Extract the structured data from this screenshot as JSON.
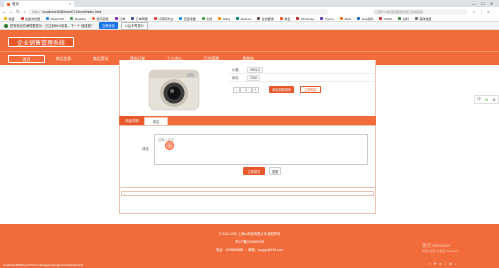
{
  "browser": {
    "tab_title": "首页",
    "tab_close": "×",
    "window_controls": [
      "—",
      "☐",
      "✕"
    ],
    "nav_glyphs": [
      "←",
      "→",
      "↻",
      "⌂"
    ],
    "url_prefix": "http://",
    "url": "localhost:8080/ssm071/front/index.html",
    "search_placeholder": "口罩什么情况还能回去用口罩用完吗",
    "right_glyphs": "☆ ⋮ ≡"
  },
  "bookmarks": [
    {
      "label": "收藏",
      "color": "#f5b400"
    },
    {
      "label": "谷歌浏览器",
      "color": "#e53935"
    },
    {
      "label": "MapuTOP",
      "color": "#1e88e5"
    },
    {
      "label": "Maplibre",
      "color": "#43a047"
    },
    {
      "label": "腾讯视频",
      "color": "#ff7043"
    },
    {
      "label": "订单",
      "color": "#8e24aa"
    },
    {
      "label": "订单明细",
      "color": "#3949ab"
    },
    {
      "label": "计算机毕业",
      "color": "#e53935"
    },
    {
      "label": "百度地图",
      "color": "#1e88e5"
    },
    {
      "label": "文档",
      "color": "#43a047"
    },
    {
      "label": "bilibili",
      "color": "#fb8c00"
    },
    {
      "label": "abstract",
      "color": "#00897b"
    },
    {
      "label": "在线翻译",
      "color": "#6d4c41"
    },
    {
      "label": "淘宝",
      "color": "#ff5722"
    },
    {
      "label": "KFCfinder",
      "color": "#c62828"
    },
    {
      "label": "Typing",
      "color": "#5e35b1"
    },
    {
      "label": "JAVA",
      "color": "#ef6c00"
    },
    {
      "label": "java资料",
      "color": "#1565c0"
    },
    {
      "label": "CSDN",
      "color": "#d32f2f"
    },
    {
      "label": "资料",
      "color": "#388e3c"
    },
    {
      "label": "其他收藏",
      "color": "#757575"
    }
  ],
  "notice": {
    "text": "您有电池充满需要提示：已达到80%电量，下一个·健康度？",
    "primary_button": "立即优化",
    "secondary_button": "以后不再提示"
  },
  "site": {
    "title": "企业销售管理系统",
    "nav": [
      "首页",
      "商品信息",
      "商品资讯",
      "我的订单",
      "个人中心",
      "后台管理",
      "购物车"
    ],
    "active_nav": "首页"
  },
  "product": {
    "fields": [
      {
        "label": "价格",
        "value": "9694.0"
      },
      {
        "label": "库存",
        "value": "2000"
      }
    ],
    "quantity": {
      "minus": "-",
      "value": "1",
      "plus": "+"
    },
    "add_to_cart_label": "添加到购物车",
    "favorite_label": "立即购买"
  },
  "reviews": {
    "tabs": [
      "商品详情",
      "评论"
    ],
    "active_tab": "评论",
    "label": "评论",
    "placeholder": "请输入评论",
    "submit_label": "立即提交",
    "reset_label": "重置",
    "cursor_label": "1",
    "pager_prev": "<",
    "pager_next": ">"
  },
  "footer": {
    "copyright": "© 2016-2020 上海xx科技有限公司 版权所有",
    "icp": "沪ICP备13080630号",
    "contact": "电话：4008888888  ｜ 邮箱：xxyygo@163.com"
  },
  "side_widget": [
    "中",
    "G",
    "⚙"
  ],
  "watermark": {
    "line1": "激活 Windows",
    "line2": "转到\"设置\"以激活 Windows。"
  },
  "status_text": "localhost:8080/ssm071/front/pages/shangpinxinxi/detail.html",
  "tray": "☁ ⚑ ✉ ♪ 中 ⌂"
}
